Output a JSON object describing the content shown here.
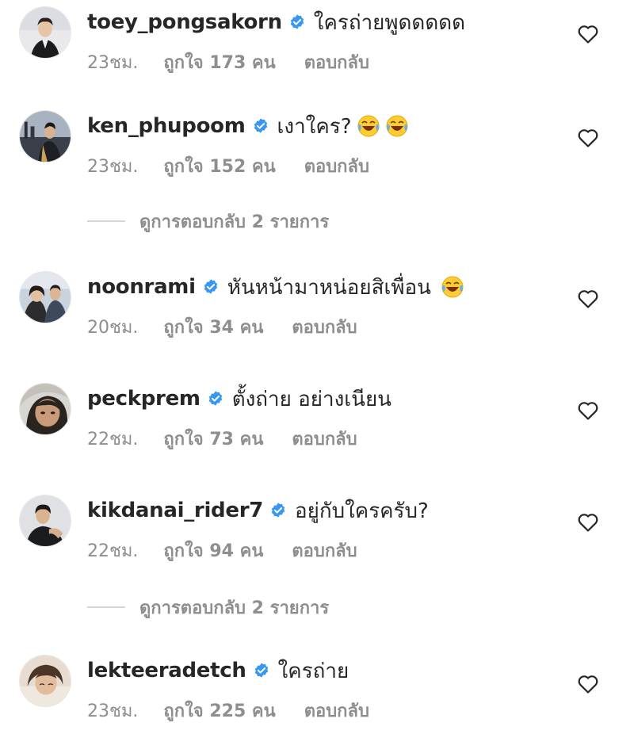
{
  "comments": [
    {
      "username": "toey_pongsakorn",
      "text": "ใครถ่ายพูดดดดด",
      "emoji": "",
      "time": "23ชม.",
      "likes": "ถูกใจ 173 คน",
      "reply": "ตอบกลับ",
      "verified": true
    },
    {
      "username": "ken_phupoom",
      "text": "เงาใคร?",
      "emoji": "😂😂",
      "time": "23ชม.",
      "likes": "ถูกใจ 152 คน",
      "reply": "ตอบกลับ",
      "verified": true
    },
    {
      "username": "noonrami",
      "text": "หันหน้ามาหน่อยสิเพื่อน",
      "emoji": "😂",
      "time": "20ชม.",
      "likes": "ถูกใจ 34 คน",
      "reply": "ตอบกลับ",
      "verified": true
    },
    {
      "username": "peckprem",
      "text": "ตั้งถ่าย อย่างเนียน",
      "emoji": "",
      "time": "22ชม.",
      "likes": "ถูกใจ 73 คน",
      "reply": "ตอบกลับ",
      "verified": true
    },
    {
      "username": "kikdanai_rider7",
      "text": "อยู่กับใครครับ?",
      "emoji": "",
      "time": "22ชม.",
      "likes": "ถูกใจ 94 คน",
      "reply": "ตอบกลับ",
      "verified": true
    },
    {
      "username": "lekteeradetch",
      "text": "ใครถ่าย",
      "emoji": "",
      "time": "23ชม.",
      "likes": "ถูกใจ 225 คน",
      "reply": "ตอบกลับ",
      "verified": true
    }
  ],
  "view_replies": [
    {
      "label": "ดูการตอบกลับ 2 รายการ"
    },
    {
      "label": "ดูการตอบกลับ 2 รายการ"
    }
  ],
  "colors": {
    "text": "#262626",
    "secondary": "#8e8e8e",
    "verified": "#3897f0",
    "divider": "#d6d6d6"
  },
  "icons": {
    "like": "heart-outline-icon",
    "verified": "verified-badge-icon",
    "emoji": "face-with-tears-of-joy"
  }
}
